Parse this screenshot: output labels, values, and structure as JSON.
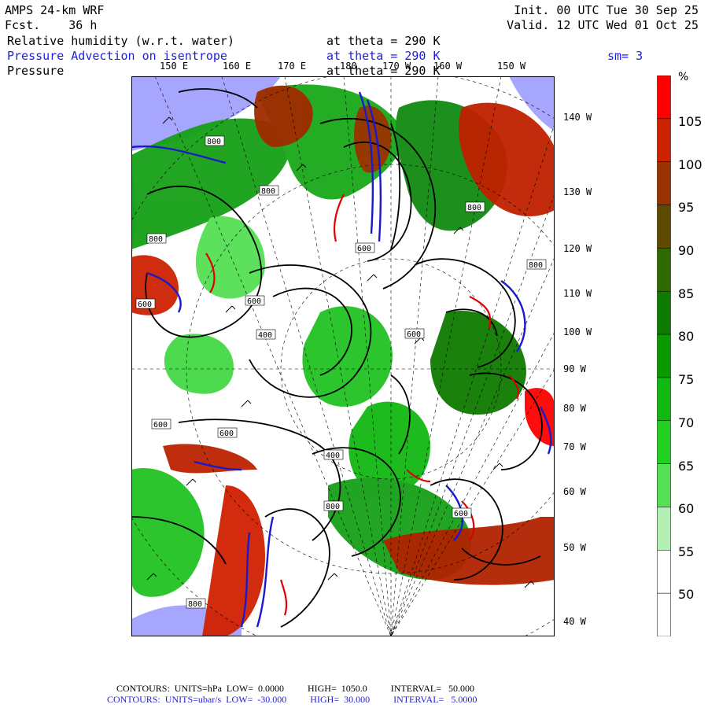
{
  "header": {
    "model": "AMPS 24-km WRF",
    "forecast_label": "Fcst.",
    "forecast_hours": "36 h",
    "init": "Init. 00 UTC Tue 30 Sep 25",
    "valid": "Valid. 12 UTC Wed 01 Oct 25",
    "field1": "Relative humidity (w.r.t. water)",
    "field1_level": "at theta = 290 K",
    "field2": "Pressure Advection on isentrope",
    "field2_level": "at theta = 290 K",
    "smoothing": "sm= 3",
    "field3": "Pressure",
    "field3_level": "at theta = 290 K"
  },
  "lon_labels_top": [
    "150 E",
    "160 E",
    "170 E",
    "180",
    "170 W",
    "160 W",
    "150 W"
  ],
  "lat_labels_right": [
    "140 W",
    "130 W",
    "120 W",
    "110 W",
    "100 W",
    "90 W",
    "80 W",
    "70 W",
    "60 W",
    "50 W",
    "40 W"
  ],
  "contour_labels": [
    "800",
    "800",
    "800",
    "800",
    "600",
    "800",
    "600",
    "600",
    "400",
    "600",
    "600",
    "400",
    "600",
    "800",
    "600",
    "800"
  ],
  "colorbar": {
    "unit": "%",
    "labels": [
      "105",
      "100",
      "95",
      "90",
      "85",
      "80",
      "75",
      "70",
      "65",
      "60",
      "55",
      "50"
    ],
    "colors": [
      "#ff0000",
      "#cc2200",
      "#993300",
      "#5e4a00",
      "#2f6a00",
      "#0e7a00",
      "#0a9a00",
      "#11b811",
      "#22d022",
      "#55e055",
      "#b4f0b4",
      "#ffffff",
      "#ffffff"
    ]
  },
  "colors": {
    "ocean": "#a6a6ff",
    "ice": "#ffffff",
    "contour_black": "#000000",
    "advection_blue": "#1a1acc",
    "advection_red": "#e00000"
  },
  "footer": {
    "line1": "CONTOURS:  UNITS=hPa  LOW=  0.0000          HIGH=  1050.0          INTERVAL=   50.000",
    "line2": "CONTOURS:  UNITS=ubar/s  LOW=  -30.000          HIGH=  30.000          INTERVAL=   5.0000"
  }
}
